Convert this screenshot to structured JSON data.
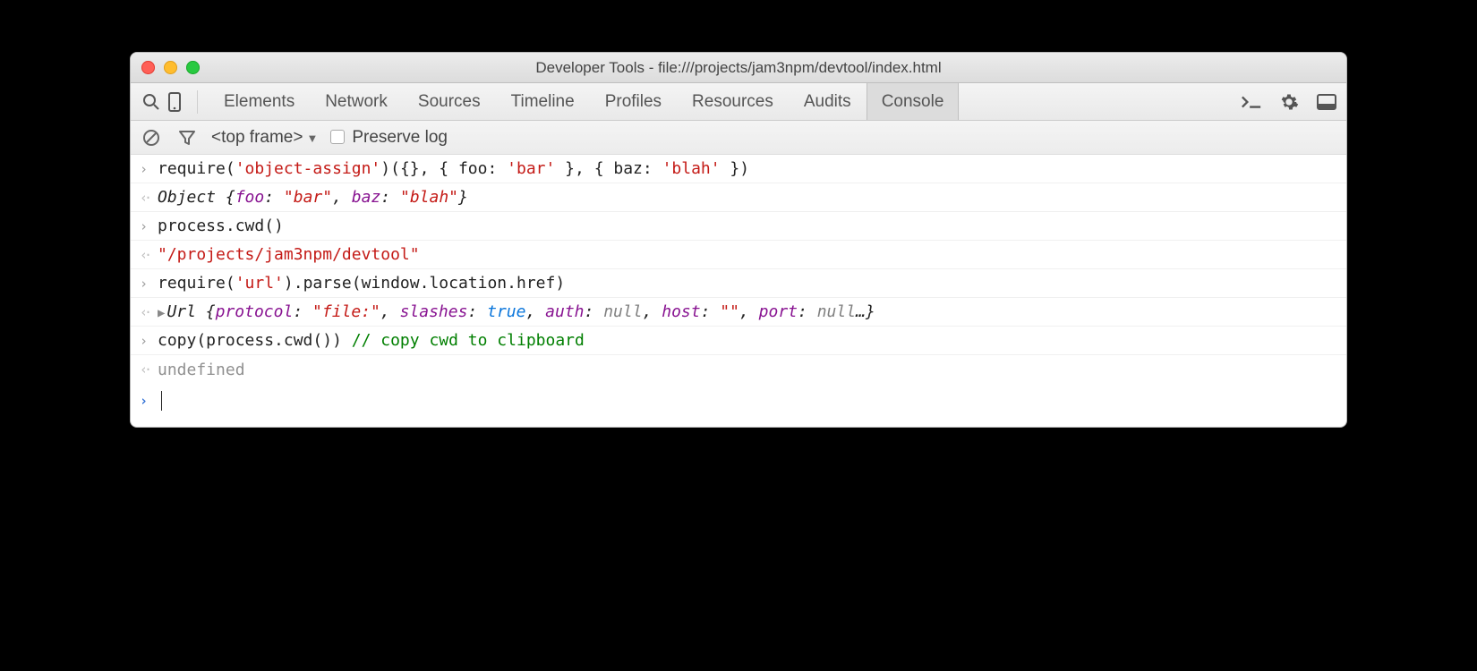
{
  "window": {
    "title": "Developer Tools - file:///projects/jam3npm/devtool/index.html"
  },
  "tabs": {
    "items": [
      "Elements",
      "Network",
      "Sources",
      "Timeline",
      "Profiles",
      "Resources",
      "Audits",
      "Console"
    ],
    "active": "Console"
  },
  "filter": {
    "frame": "<top frame>",
    "preserve_label": "Preserve log",
    "preserve_checked": false
  },
  "console": {
    "e0_in": {
      "a": "require(",
      "b": "'object-assign'",
      "c": ")({}, { foo: ",
      "d": "'bar'",
      "e": " }, { baz: ",
      "f": "'blah'",
      "g": " })"
    },
    "e0_out": {
      "pre": "Object {",
      "k1": "foo",
      "sep1": ": ",
      "v1": "\"bar\"",
      "comma": ", ",
      "k2": "baz",
      "sep2": ": ",
      "v2": "\"blah\"",
      "post": "}"
    },
    "e1_in": "process.cwd()",
    "e1_out": "\"/projects/jam3npm/devtool\"",
    "e2_in": {
      "a": "require(",
      "b": "'url'",
      "c": ").parse(window.location.href)"
    },
    "e2_out": {
      "pre": "Url {",
      "k1": "protocol",
      "sep": ": ",
      "v1": "\"file:\"",
      "k2": "slashes",
      "v2": "true",
      "k3": "auth",
      "v3": "null",
      "k4": "host",
      "v4": "\"\"",
      "k5": "port",
      "v5": "null",
      "post": "…}"
    },
    "e3_in": {
      "code": "copy(process.cwd()) ",
      "comment": "// copy cwd to clipboard"
    },
    "e3_out": "undefined"
  }
}
